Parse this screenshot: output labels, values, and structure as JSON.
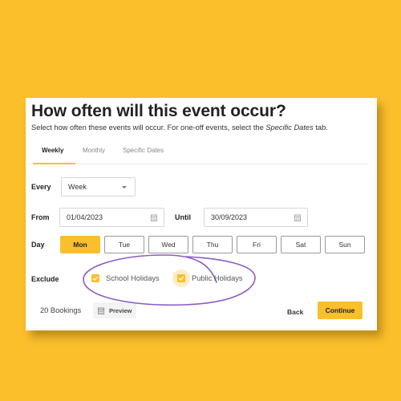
{
  "colors": {
    "background": "#fbbf2c",
    "accent": "#fbbf2c",
    "annotation": "#8a5cc7"
  },
  "header": {
    "title": "How often will this event occur?",
    "subtitle_prefix": "Select how often these events will occur. For one-off events, select the ",
    "subtitle_emphasis": "Specific Dates",
    "subtitle_suffix": " tab."
  },
  "tabs": [
    {
      "label": "Weekly",
      "active": true
    },
    {
      "label": "Monthly",
      "active": false
    },
    {
      "label": "Specific Dates",
      "active": false
    }
  ],
  "form": {
    "every_label": "Every",
    "every_value": "Week",
    "from_label": "From",
    "from_value": "01/04/2023",
    "until_label": "Until",
    "until_value": "30/09/2023",
    "day_label": "Day",
    "days": [
      {
        "label": "Mon",
        "selected": true
      },
      {
        "label": "Tue",
        "selected": false
      },
      {
        "label": "Wed",
        "selected": false
      },
      {
        "label": "Thu",
        "selected": false
      },
      {
        "label": "Fri",
        "selected": false
      },
      {
        "label": "Sat",
        "selected": false
      },
      {
        "label": "Sun",
        "selected": false
      }
    ],
    "exclude_label": "Exclude",
    "exclusions": [
      {
        "label": "School Holidays",
        "checked": true
      },
      {
        "label": "Public Holidays",
        "checked": true
      }
    ]
  },
  "footer": {
    "bookings": "20 Bookings",
    "preview_label": "Preview",
    "back_label": "Back",
    "continue_label": "Continue"
  },
  "icons": {
    "dropdown": "chevron-down-icon",
    "date": "calendar-icon",
    "checkbox": "check-icon"
  }
}
